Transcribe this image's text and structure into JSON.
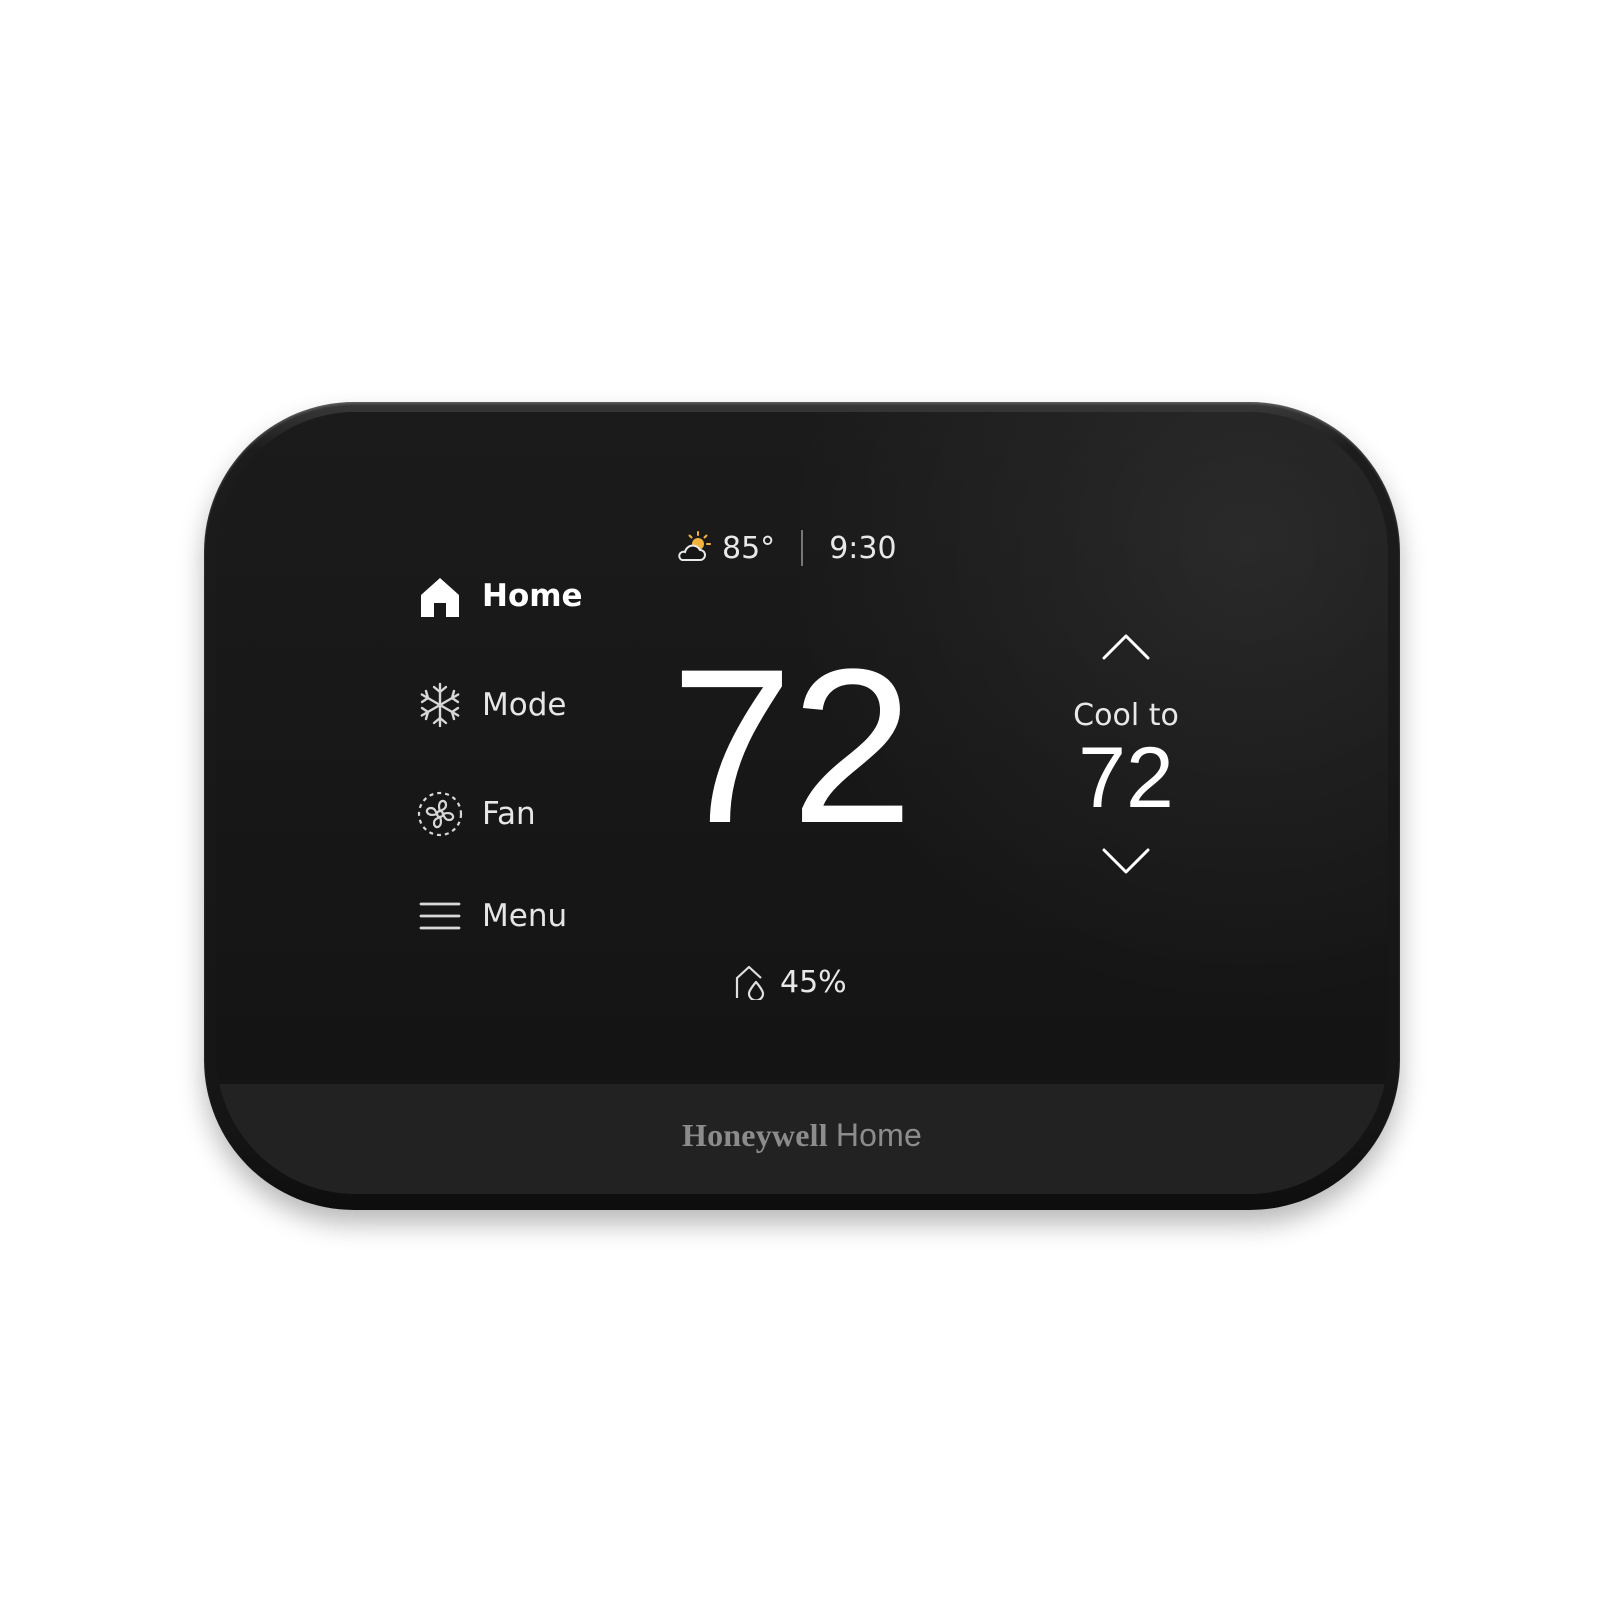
{
  "device": {
    "screen": {
      "weather": {
        "icon": "partly-sunny-icon",
        "outdoor_temp": "85°"
      },
      "time": "9:30",
      "current_temp": "72",
      "humidity": {
        "icon": "humidity-drop-icon",
        "value": "45%"
      },
      "setpoint": {
        "label": "Cool to",
        "value": "72",
        "up_icon": "chevron-up-icon",
        "down_icon": "chevron-down-icon"
      },
      "nav": {
        "items": [
          {
            "label": "Home",
            "icon": "home-icon",
            "active": true
          },
          {
            "label": "Mode",
            "icon": "snowflake-icon",
            "active": false
          },
          {
            "label": "Fan",
            "icon": "fan-icon",
            "active": false
          },
          {
            "label": "Menu",
            "icon": "hamburger-menu-icon",
            "active": false
          }
        ]
      }
    },
    "brand": {
      "name": "Honeywell",
      "suffix": "Home"
    }
  },
  "colors": {
    "screen_bg": "#141414",
    "text_primary": "#ffffff",
    "brand_text": "#8c8c8c"
  }
}
